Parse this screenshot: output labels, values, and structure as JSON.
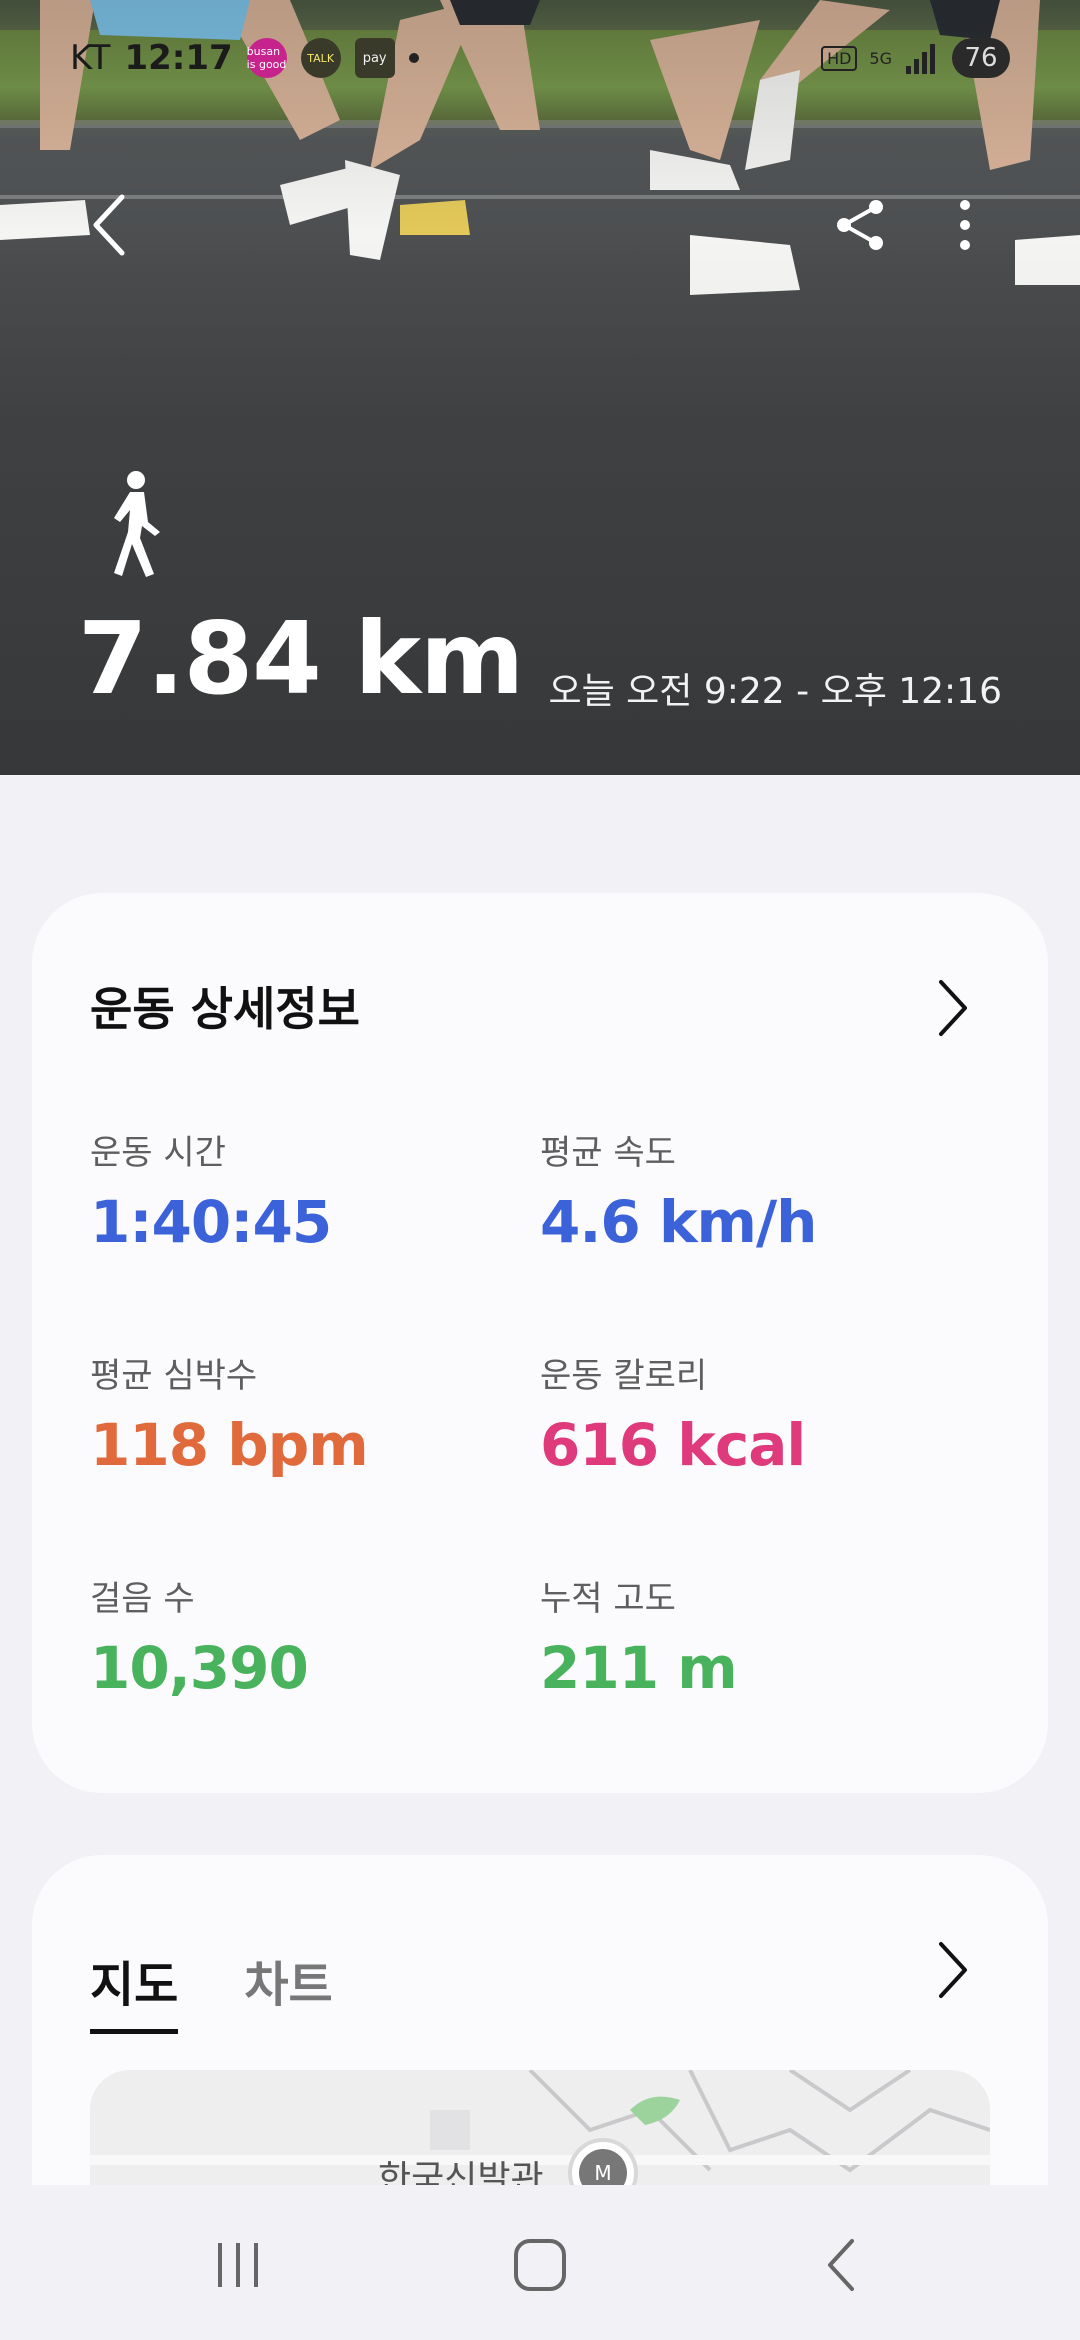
{
  "status_bar": {
    "carrier": "KT",
    "time": "12:17",
    "badges": {
      "busan": "busan is good",
      "talk": "TALK",
      "pay": "pay"
    },
    "hd": "HD",
    "network": "5G",
    "battery": "76"
  },
  "hero": {
    "distance": "7.84 km",
    "time_range": "오늘 오전 9:22 - 오후 12:16",
    "activity_icon": "walking-person-icon"
  },
  "details": {
    "title": "운동 상세정보",
    "metrics": [
      {
        "label": "운동 시간",
        "value": "1:40:45",
        "color": "#3b62d9"
      },
      {
        "label": "평균 속도",
        "value": "4.6 km/h",
        "color": "#3b62d9"
      },
      {
        "label": "평균 심박수",
        "value": "118 bpm",
        "color": "#e06a3c"
      },
      {
        "label": "운동 칼로리",
        "value": "616 kcal",
        "color": "#de3a7c"
      },
      {
        "label": "걸음 수",
        "value": "10,390",
        "color": "#49b25c"
      },
      {
        "label": "누적 고도",
        "value": "211 m",
        "color": "#49b25c"
      }
    ]
  },
  "map_card": {
    "tabs": [
      {
        "label": "지도"
      },
      {
        "label": "차트"
      }
    ],
    "map_label": "한국신발관"
  }
}
